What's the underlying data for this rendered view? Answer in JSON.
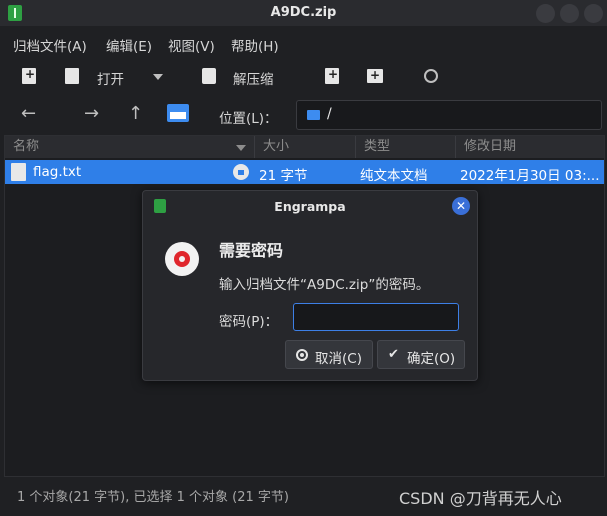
{
  "window": {
    "title": "A9DC.zip"
  },
  "menu": [
    "归档文件(A)",
    "编辑(E)",
    "视图(V)",
    "帮助(H)"
  ],
  "toolbar": {
    "open_label": "打开",
    "extract_label": "解压缩"
  },
  "location": {
    "label": "位置(L)：",
    "path": "/"
  },
  "columns": [
    "名称",
    "大小",
    "类型",
    "修改日期"
  ],
  "rows": [
    {
      "name": "flag.txt",
      "size": "21 字节",
      "type": "纯文本文档",
      "modified": "2022年1月30日 03:..."
    }
  ],
  "status": "1 个对象(21 字节), 已选择 1 个对象 (21 字节)",
  "watermark": "CSDN @刀背再无人心",
  "dialog": {
    "title": "Engrampa",
    "heading": "需要密码",
    "message": "输入归档文件“A9DC.zip”的密码。",
    "password_label": "密码(P)：",
    "password_value": "",
    "cancel_label": "取消(C)",
    "ok_label": "确定(O)"
  },
  "colors": {
    "selection": "#2f7fe8",
    "accent": "#3d7fe6",
    "app_icon": "#2ea043",
    "key_icon": "#e0262c"
  },
  "icons": {
    "app": "archive-icon",
    "new": "new-archive-icon",
    "open": "open-icon",
    "extract": "extract-icon",
    "add_file": "add-file-icon",
    "add_folder": "add-folder-icon",
    "stop": "stop-icon",
    "back": "back-arrow-icon",
    "forward": "forward-arrow-icon",
    "up": "up-arrow-icon",
    "home": "home-folder-icon",
    "file": "text-file-icon",
    "lock": "lock-icon",
    "key": "password-key-icon",
    "close": "close-icon",
    "cancel": "cancel-icon",
    "ok": "check-icon"
  }
}
